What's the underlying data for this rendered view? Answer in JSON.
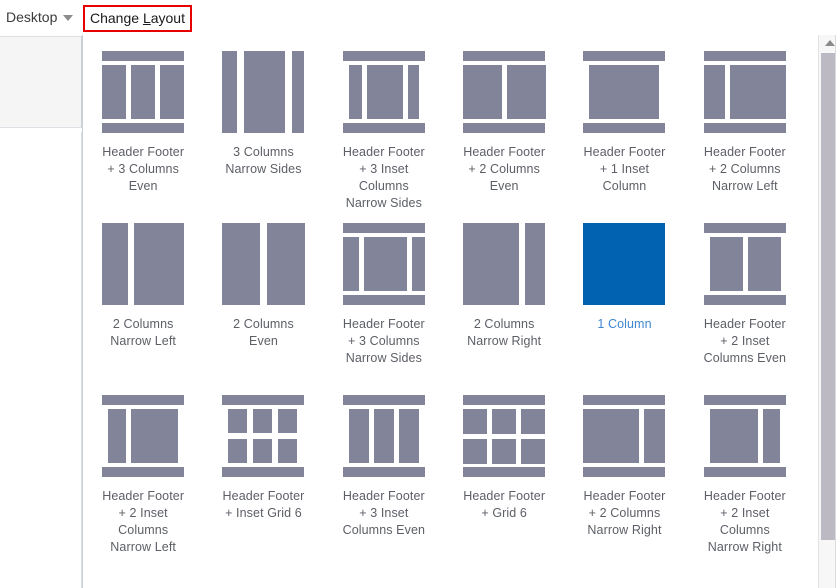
{
  "toolbar": {
    "device_label": "Desktop",
    "device_caret_icon": "chevron-down-icon",
    "change_layout_label_pre": "Change ",
    "change_layout_accesskey": "L",
    "change_layout_label_post": "ayout",
    "highlight_color": "#e60000"
  },
  "colors": {
    "block": "#82849a",
    "selected": "#0062b1",
    "selected_text": "#3f87d0",
    "label_text": "#5c5f66"
  },
  "scrollbar": {
    "up_arrow_icon": "triangle-up-icon",
    "position": "top"
  },
  "layouts": [
    {
      "label": "Header Footer\n+ 3 Columns\nEven",
      "type": "hf-3col-even",
      "selected": false
    },
    {
      "label": "3 Columns\nNarrow Sides",
      "type": "3col-narrow-sides",
      "selected": false
    },
    {
      "label": "Header Footer\n+ 3 Inset\nColumns\nNarrow Sides",
      "type": "hf-3inset-narrow-sides",
      "selected": false
    },
    {
      "label": "Header Footer\n+ 2 Columns\nEven",
      "type": "hf-2col-even",
      "selected": false
    },
    {
      "label": "Header Footer\n+ 1 Inset\nColumn",
      "type": "hf-1inset",
      "selected": false
    },
    {
      "label": "Header Footer\n+ 2 Columns\nNarrow Left",
      "type": "hf-2col-narrow-left",
      "selected": false
    },
    {
      "label": "2 Columns\nNarrow Left",
      "type": "2col-narrow-left",
      "selected": false
    },
    {
      "label": "2 Columns\nEven",
      "type": "2col-even",
      "selected": false
    },
    {
      "label": "Header Footer\n+ 3 Columns\nNarrow Sides",
      "type": "hf-3col-narrow-sides",
      "selected": false
    },
    {
      "label": "2 Columns\nNarrow Right",
      "type": "2col-narrow-right",
      "selected": false
    },
    {
      "label": "1 Column",
      "type": "1col",
      "selected": true
    },
    {
      "label": "Header Footer\n+ 2 Inset\nColumns Even",
      "type": "hf-2inset-even",
      "selected": false
    },
    {
      "label": "Header Footer\n+ 2 Inset\nColumns\nNarrow Left",
      "type": "hf-2inset-narrow-left",
      "selected": false
    },
    {
      "label": "Header Footer\n+ Inset Grid 6",
      "type": "hf-inset-grid6",
      "selected": false
    },
    {
      "label": "Header Footer\n+ 3 Inset\nColumns Even",
      "type": "hf-3inset-even",
      "selected": false
    },
    {
      "label": "Header Footer\n+ Grid 6",
      "type": "hf-grid6",
      "selected": false
    },
    {
      "label": "Header Footer\n+ 2 Columns\nNarrow Right",
      "type": "hf-2col-narrow-right",
      "selected": false
    },
    {
      "label": "Header Footer\n+ 2 Inset\nColumns\nNarrow Right",
      "type": "hf-2inset-narrow-right",
      "selected": false
    }
  ]
}
